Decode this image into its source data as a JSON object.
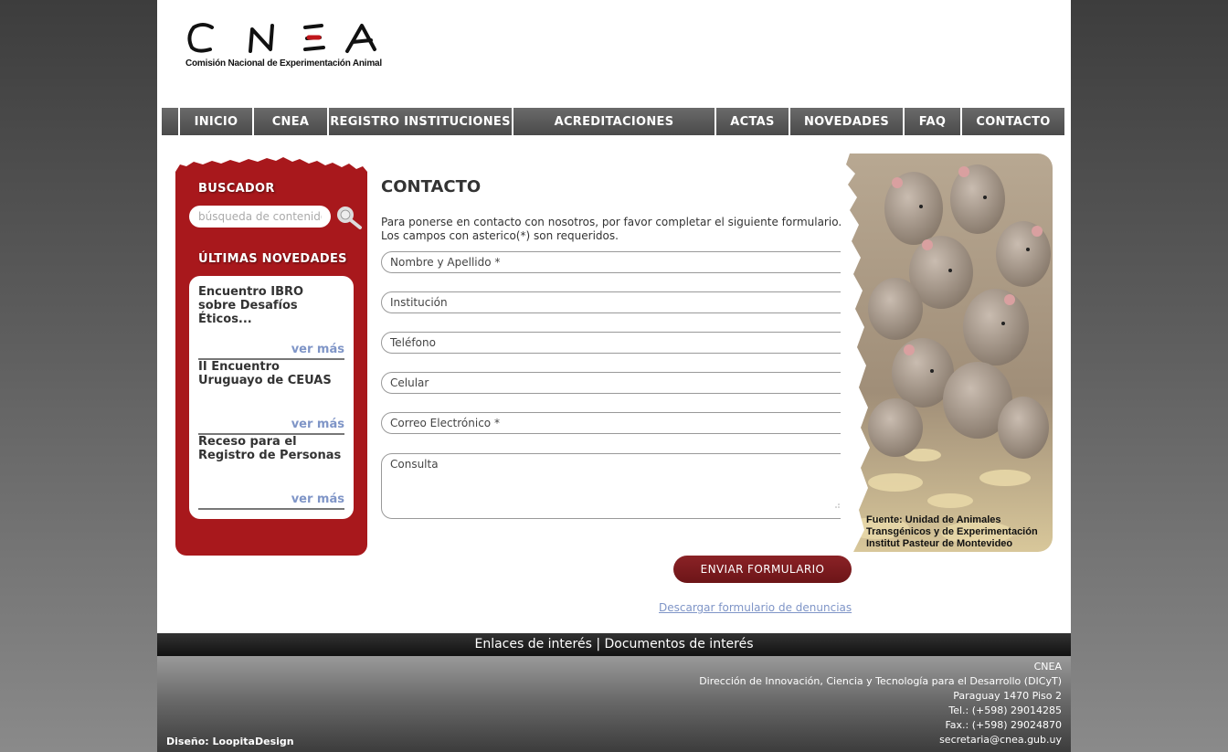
{
  "header": {
    "logo_text": "CNEA",
    "logo_subtitle": "Comisión Nacional de Experimentación Animal"
  },
  "nav": {
    "items": [
      "INICIO",
      "CNEA",
      "REGISTRO INSTITUCIONES",
      "ACREDITACIONES",
      "ACTAS",
      "NOVEDADES",
      "FAQ",
      "CONTACTO"
    ]
  },
  "sidebar": {
    "search_heading": "BUSCADOR",
    "search_placeholder": "búsqueda de contenido",
    "news_heading": "ÚLTIMAS NOVEDADES",
    "news": [
      {
        "title": "Encuentro IBRO sobre Desafíos Éticos...",
        "more": "ver más"
      },
      {
        "title": "II Encuentro Uruguayo de CEUAS",
        "more": "ver más"
      },
      {
        "title": "Receso para el Registro de Personas",
        "more": "ver más"
      }
    ]
  },
  "main": {
    "title": "CONTACTO",
    "intro_line1": "Para ponerse en contacto con nosotros, por favor completar el siguiente formulario.",
    "intro_line2": "Los campos con asterico(*) son requeridos.",
    "fields": {
      "name": "Nombre y Apellido *",
      "institution": "Institución",
      "phone": "Teléfono",
      "mobile": "Celular",
      "email": "Correo Electrónico *",
      "message": "Consulta"
    },
    "submit_label": "ENVIAR FORMULARIO",
    "download_link": "Descargar formulario de denuncias",
    "photo_caption": {
      "line1": "Fuente: Unidad de Animales",
      "line2": "Transgénicos y de Experimentación",
      "line3": "Institut Pasteur de Montevideo"
    }
  },
  "footer": {
    "links": {
      "enlaces": "Enlaces de interés",
      "separator": "|",
      "documentos": "Documentos de interés"
    },
    "info": [
      "CNEA",
      "Dirección de Innovación, Ciencia y Tecnología para el Desarrollo (DICyT)",
      "Paraguay 1470 Piso 2",
      "Tel.: (+598) 29014285",
      "Fax.: (+598) 29024870",
      "secretaria@cnea.gub.uy"
    ],
    "design_credit": "Diseño: LoopitaDesign"
  },
  "colors": {
    "sidebar_red": "#a8181c",
    "nav_gray": "#555555",
    "link_blue": "#7f95c7",
    "button_red": "#7a1a1e"
  }
}
